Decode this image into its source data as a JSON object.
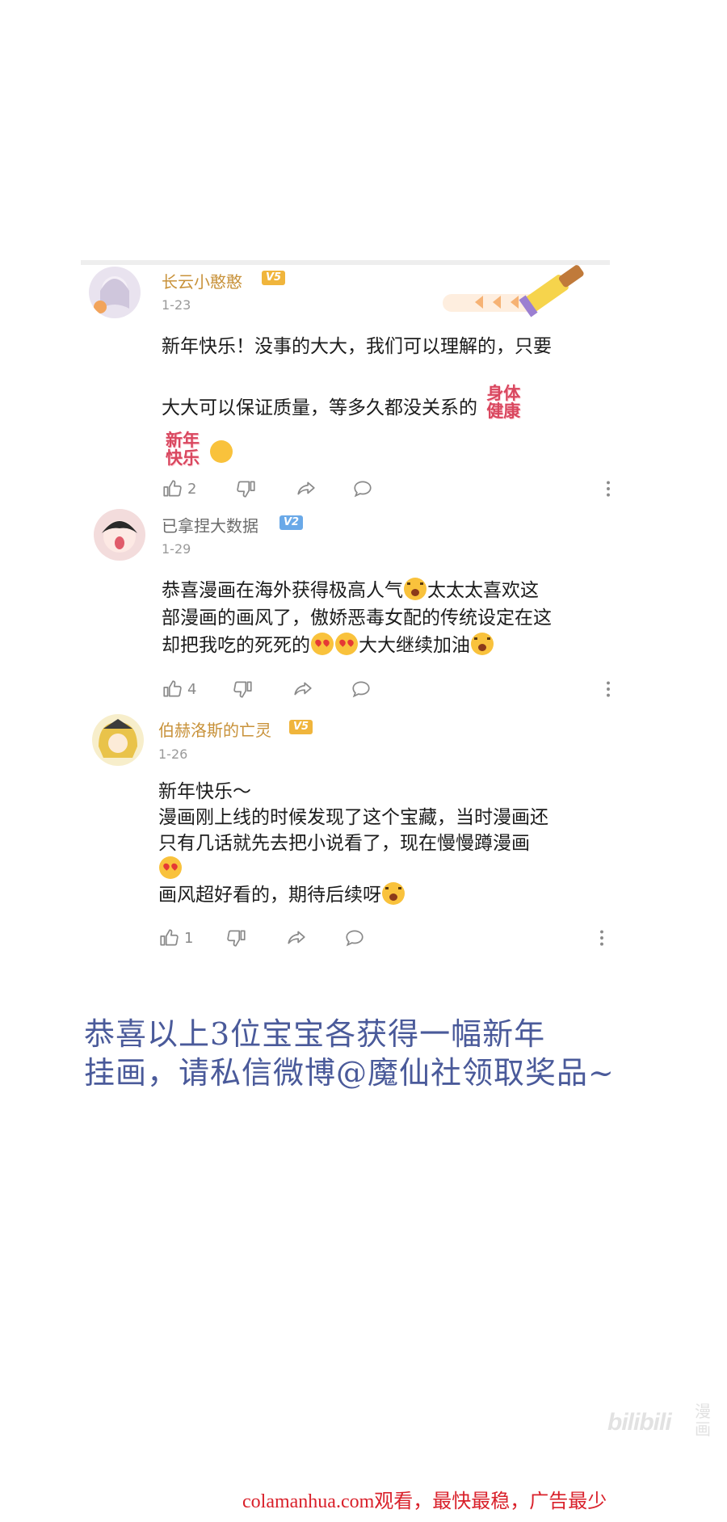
{
  "comments": [
    {
      "username": "长云小憨憨",
      "level": "V5",
      "date": "1-23",
      "lines": [
        "新年快乐！没事的大大，我们可以理解的，只要",
        "大大可以保证质量，等多久都没关系的"
      ],
      "sticker_1": "身体健康",
      "sticker_2": "新年快乐",
      "likes": "2"
    },
    {
      "username": "已拿捏大数据",
      "level": "V2",
      "date": "1-29",
      "lines": [
        "恭喜漫画在海外获得极高人气",
        "太太太喜欢这",
        "部漫画的画风了，傲娇恶毒女配的传统设定在这",
        "却把我吃的死死的",
        "大大继续加油"
      ],
      "likes": "4"
    },
    {
      "username": "伯赫洛斯的亡灵",
      "level": "V5",
      "date": "1-26",
      "lines": [
        "新年快乐～",
        "漫画刚上线的时候发现了这个宝藏，当时漫画还",
        "只有几话就先去把小说看了，现在慢慢蹲漫画",
        "画风超好看的，期待后续呀"
      ],
      "likes": "1"
    }
  ],
  "announcement": [
    "恭喜以上3位宝宝各获得一幅新年",
    "挂画，请私信微博@魔仙社领取奖品~"
  ],
  "watermark": {
    "brand": "bilibili",
    "sub": "漫画"
  },
  "source_line": "colamanhua.com观看，最快最稳，广告最少",
  "icons": [
    "like-icon",
    "dislike-icon",
    "share-icon",
    "reply-icon",
    "more-icon"
  ],
  "colors": {
    "username_gold": "#c8923a",
    "announcement": "#4a5a9a",
    "source_red": "#d9202a"
  }
}
